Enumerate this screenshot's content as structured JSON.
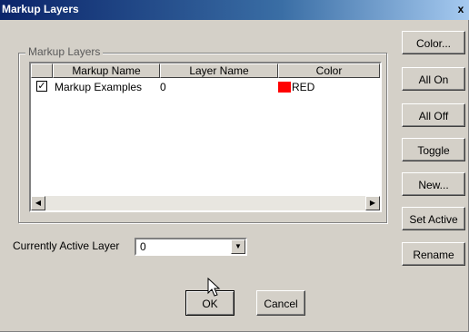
{
  "window": {
    "title": "Markup Layers",
    "close_glyph": "x"
  },
  "group": {
    "label": "Markup Layers"
  },
  "columns": [
    "Markup Name",
    "Layer Name",
    "Color"
  ],
  "rows": [
    {
      "checked": true,
      "check_glyph": "✓",
      "name": "Markup Examples",
      "layer": "0",
      "color_name": "RED",
      "color_hex": "#ff0000"
    }
  ],
  "scroll": {
    "left_glyph": "◀",
    "right_glyph": "▶"
  },
  "buttons": {
    "color": "Color...",
    "all_on": "All On",
    "all_off": "All Off",
    "toggle": "Toggle",
    "new": "New...",
    "set_active": "Set Active",
    "rename": "Rename",
    "ok": "OK",
    "cancel": "Cancel"
  },
  "active_layer": {
    "label": "Currently Active Layer",
    "value": "0",
    "dropdown_glyph": "▼"
  }
}
